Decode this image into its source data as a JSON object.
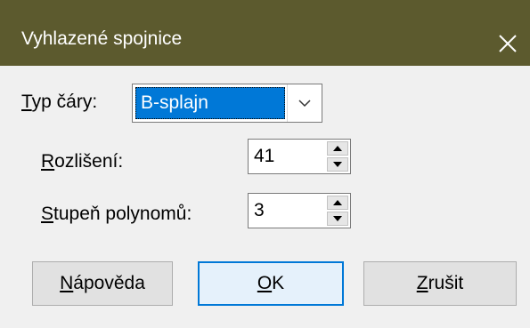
{
  "dialog": {
    "title": "Vyhlazené spojnice",
    "close_icon": "close-icon"
  },
  "line_type": {
    "label_mnemonic": "T",
    "label_rest": "yp čáry:",
    "value": "B-splajn",
    "arrow_icon": "chevron-down-icon"
  },
  "resolution": {
    "label_mnemonic": "R",
    "label_rest": "ozlišení:",
    "value": "41"
  },
  "degree": {
    "label_mnemonic": "S",
    "label_rest": "tupeň polynomů:",
    "value": "3"
  },
  "buttons": {
    "help_mnemonic": "N",
    "help_rest": "ápověda",
    "ok_mnemonic": "O",
    "ok_rest": "K",
    "cancel_mnemonic": "Z",
    "cancel_rest": "rušit"
  }
}
